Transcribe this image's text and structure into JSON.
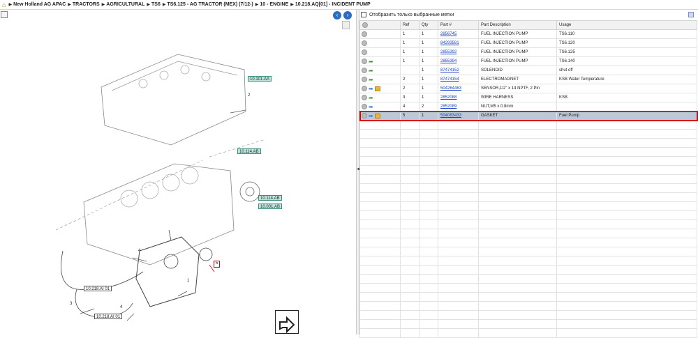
{
  "breadcrumb": [
    "New Holland AG APAC",
    "TRACTORS",
    "AGRICULTURAL",
    "TS6",
    "TS6.125 - AG TRACTOR (MEX) (7/12-)",
    "10 - ENGINE",
    "10.218.AQ[01] - INCIDENT PUMP"
  ],
  "filter": {
    "label": "Отобразить только выбранные метки"
  },
  "table": {
    "headers": [
      "Ref",
      "Qty",
      "Part #",
      "Part Description",
      "Usage"
    ],
    "rows": [
      {
        "ref": "1",
        "qty": "1",
        "part": "2856745",
        "desc": "FUEL INJECTION PUMP",
        "usage": "TS6.110",
        "icons": [
          "circle"
        ]
      },
      {
        "ref": "1",
        "qty": "1",
        "part": "84293581",
        "desc": "FUEL INJECTION PUMP",
        "usage": "TS6.120",
        "icons": [
          "circle"
        ]
      },
      {
        "ref": "1",
        "qty": "1",
        "part": "2855392",
        "desc": "FUEL INJECTION PUMP",
        "usage": "TS6.125",
        "icons": [
          "circle"
        ]
      },
      {
        "ref": "1",
        "qty": "1",
        "part": "2855394",
        "desc": "FUEL INJECTION PUMP",
        "usage": "TS6.140",
        "icons": [
          "circle",
          "arrow-green"
        ]
      },
      {
        "ref": "",
        "qty": "1",
        "part": "87474152",
        "desc": "SOLENOID",
        "usage": "shut off",
        "icons": [
          "circle",
          "arrow-green"
        ]
      },
      {
        "ref": "2",
        "qty": "1",
        "part": "87474154",
        "desc": "ELECTROMAGNET",
        "usage": "KSB Water Temperature",
        "icons": [
          "circle",
          "arrow-green"
        ]
      },
      {
        "ref": "2",
        "qty": "1",
        "part": "504264463",
        "desc": "SENSOR,1/2\" x 14 NPTF, 2 Pin",
        "usage": "",
        "icons": [
          "circle",
          "arrow-blue",
          "box"
        ]
      },
      {
        "ref": "3",
        "qty": "1",
        "part": "2852088",
        "desc": "WIRE HARNESS",
        "usage": "KSB",
        "icons": [
          "circle",
          "arrow-green"
        ]
      },
      {
        "ref": "4",
        "qty": "2",
        "part": "2852089",
        "desc": "NUT,M5 x 0.8mm",
        "usage": "",
        "icons": [
          "circle",
          "arrow-blue"
        ]
      },
      {
        "ref": "5",
        "qty": "1",
        "part": "504083433",
        "desc": "GASKET",
        "usage": "Fuel Pump",
        "icons": [
          "circle",
          "arrow-blue",
          "box"
        ],
        "selected": true
      }
    ],
    "empty_rows": 24
  },
  "diagram": {
    "callouts": [
      "10.101.AA",
      "10.114.AB",
      "10.114.AB",
      "10.001.AB",
      "10.218.AI 01",
      "10.218.AI 01"
    ],
    "refs": [
      "2",
      "4",
      "1",
      "3",
      "4",
      "5"
    ]
  },
  "colors": {
    "selected_row": "#b9c9d8",
    "highlight": "#dd0000",
    "callout": "#bfe3d9",
    "link": "#1a44c8"
  }
}
